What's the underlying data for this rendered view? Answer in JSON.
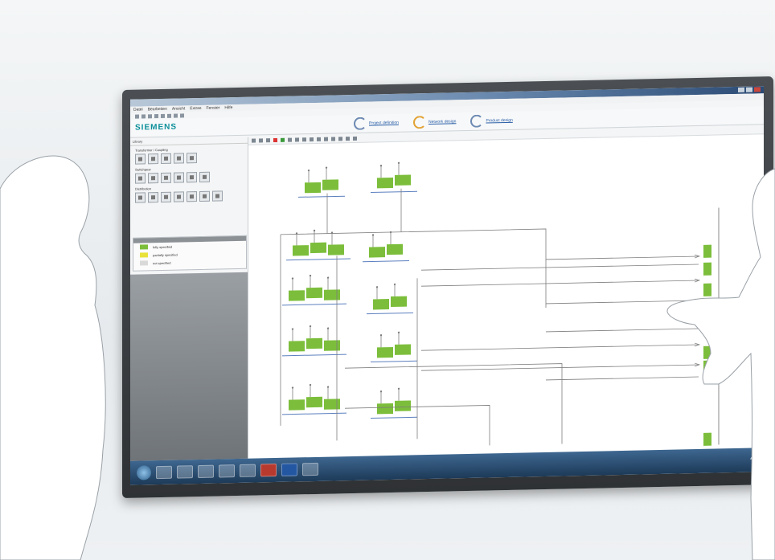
{
  "app": {
    "brand": "SIEMENS",
    "menu": [
      "Datei",
      "Bearbeiten",
      "Ansicht",
      "Extras",
      "Fenster",
      "Hilfe"
    ]
  },
  "nav": {
    "links": [
      {
        "label": "Project definition",
        "icon": "progress-arc-icon"
      },
      {
        "label": "Network design",
        "icon": "progress-arc-icon"
      },
      {
        "label": "Product design",
        "icon": "progress-arc-icon"
      }
    ]
  },
  "sidebar": {
    "header": "Library",
    "sections": [
      {
        "title": "Transformer / Coupling",
        "tiles": 5
      },
      {
        "title": "Switchgear",
        "tiles": 6
      },
      {
        "title": "Distribution",
        "tiles": 7
      }
    ],
    "legend": [
      {
        "label": "fully specified",
        "color": "#7cbe3b"
      },
      {
        "label": "partially specified",
        "color": "#e9e23a"
      },
      {
        "label": "not specified",
        "color": "#d9d9d9"
      }
    ]
  },
  "colors": {
    "block": "#7cbe3b",
    "line": "#7d7d7d",
    "accent": "#0b8f9a"
  }
}
